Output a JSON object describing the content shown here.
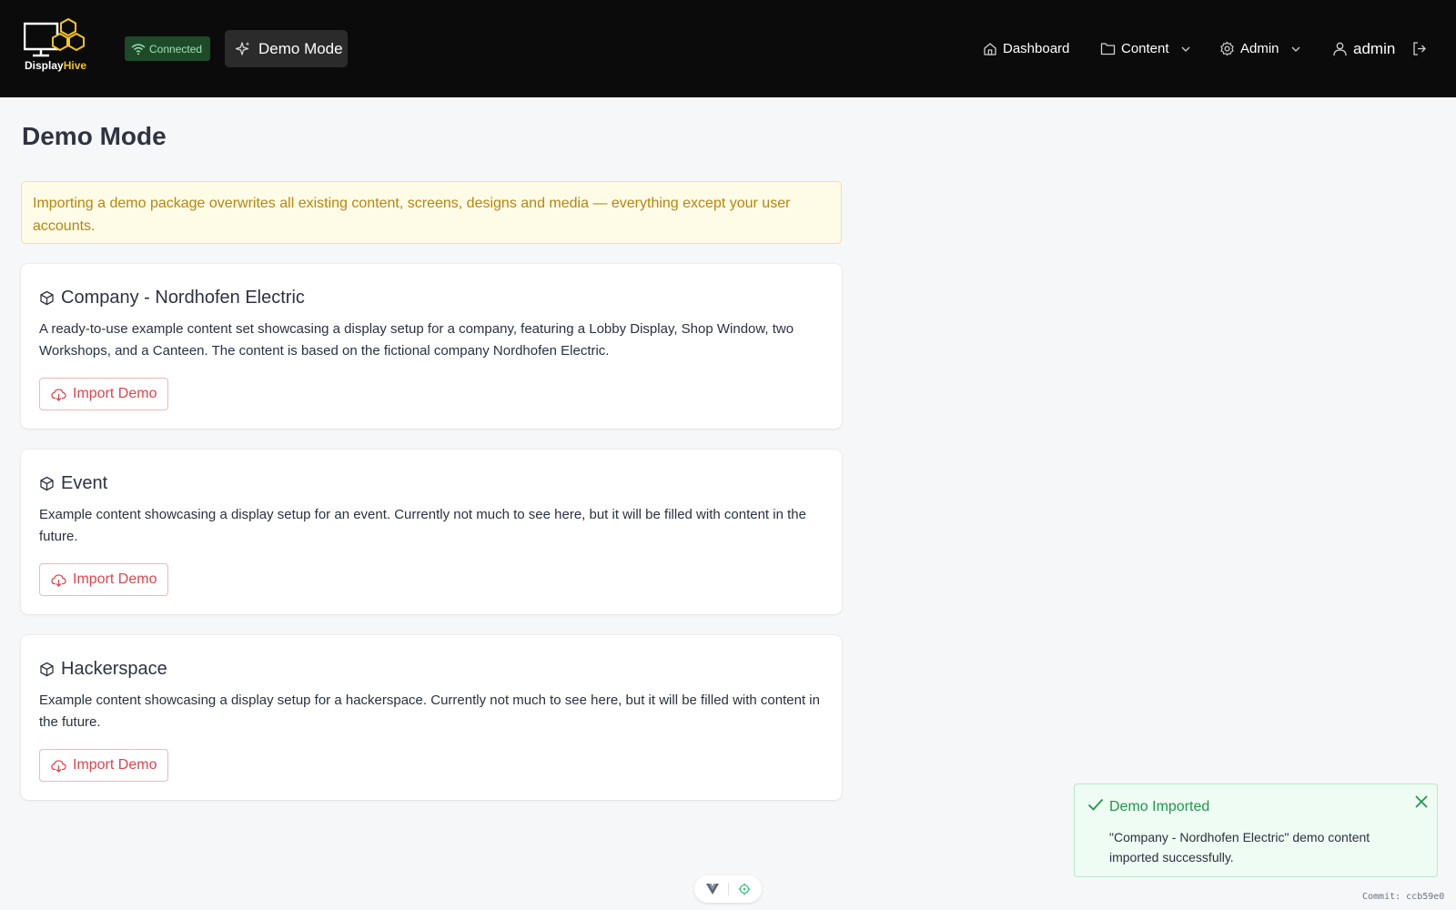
{
  "header": {
    "logo_prefix": "Display",
    "logo_suffix": "Hive",
    "connection_status": "Connected",
    "demo_mode_label": "Demo Mode",
    "nav": {
      "dashboard": "Dashboard",
      "content": "Content",
      "admin": "Admin",
      "user": "admin"
    }
  },
  "page": {
    "title": "Demo Mode",
    "warning": "Importing a demo package overwrites all existing content, screens, designs and media — everything except your user accounts."
  },
  "demos": [
    {
      "title": "Company - Nordhofen Electric",
      "description": "A ready-to-use example content set showcasing a display setup for a company, featuring a Lobby Display, Shop Window, two Workshops, and a Canteen. The content is based on the fictional company Nordhofen Electric.",
      "button": "Import Demo"
    },
    {
      "title": "Event",
      "description": "Example content showcasing a display setup for an event. Currently not much to see here, but it will be filled with content in the future.",
      "button": "Import Demo"
    },
    {
      "title": "Hackerspace",
      "description": "Example content showcasing a display setup for a hackerspace. Currently not much to see here, but it will be filled with content in the future.",
      "button": "Import Demo"
    }
  ],
  "toast": {
    "title": "Demo Imported",
    "message": "\"Company - Nordhofen Electric\" demo content imported successfully."
  },
  "footer": {
    "commit": "Commit: ccb59e0"
  },
  "colors": {
    "header_bg": "#0b0b0b",
    "accent_red": "#e0444c",
    "warning_text": "#b8860b",
    "success_green": "#1c9a4a",
    "logo_yellow": "#f5c518"
  }
}
